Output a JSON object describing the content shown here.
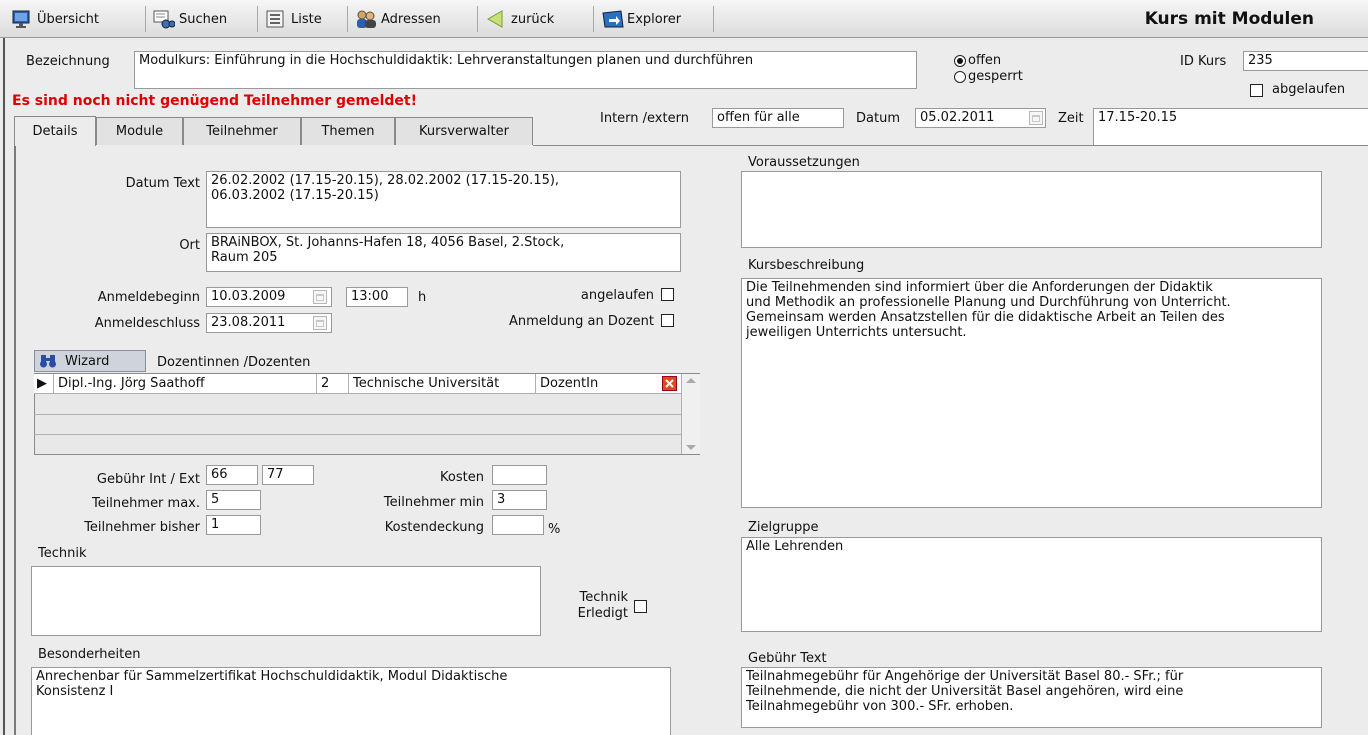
{
  "toolbar": {
    "overview": "Übersicht",
    "search": "Suchen",
    "list": "Liste",
    "addresses": "Adressen",
    "back": "zurück",
    "explorer": "Explorer",
    "title": "Kurs mit Modulen"
  },
  "header": {
    "designation_label": "Bezeichnung",
    "designation_value": "Modulkurs: Einführung in die Hochschuldidaktik: Lehrveranstaltungen planen und durchführen",
    "status_open": "offen",
    "status_locked": "gesperrt",
    "id_label": "ID Kurs",
    "id_value": "235",
    "expired_label": "abgelaufen",
    "warning": "Es sind noch nicht genügend Teilnehmer gemeldet!",
    "intern_label": "Intern /extern",
    "intern_value": "offen für alle",
    "date_label": "Datum",
    "date_value": "05.02.2011",
    "time_label": "Zeit",
    "time_value": "17.15-20.15"
  },
  "tabs": [
    "Details",
    "Module",
    "Teilnehmer",
    "Themen",
    "Kursverwalter"
  ],
  "details": {
    "date_text_label": "Datum Text",
    "date_text_value": "26.02.2002 (17.15-20.15), 28.02.2002 (17.15-20.15),\n06.03.2002 (17.15-20.15)",
    "location_label": "Ort",
    "location_value": "BRAiNBOX, St. Johanns-Hafen 18, 4056 Basel, 2.Stock,\nRaum 205",
    "reg_start_label": "Anmeldebeginn",
    "reg_start_date": "10.03.2009",
    "reg_start_time": "13:00",
    "hour_unit": "h",
    "started_label": "angelaufen",
    "reg_end_label": "Anmeldeschluss",
    "reg_end_date": "23.08.2011",
    "reg_lecturer_label": "Anmeldung an Dozent",
    "wizard_label": "Wizard",
    "lecturers_label": "Dozentinnen /Dozenten",
    "lecturers": [
      {
        "name": "Dipl.-Ing. Jörg Saathoff",
        "num": "2",
        "institution": "Technische Universität",
        "role": "DozentIn"
      }
    ],
    "fee_label": "Gebühr Int / Ext",
    "fee_int": "66",
    "fee_ext": "77",
    "cost_label": "Kosten",
    "cost_value": "",
    "max_label": "Teilnehmer max.",
    "max_value": "5",
    "min_label": "Teilnehmer min",
    "min_value": "3",
    "current_label": "Teilnehmer bisher",
    "current_value": "1",
    "coverage_label": "Kostendeckung",
    "coverage_value": "",
    "percent": "%",
    "tech_label": "Technik",
    "tech_value": "",
    "tech_done_label": "Technik\nErledigt",
    "special_label": "Besonderheiten",
    "special_value": "Anrechenbar für Sammelzertifikat Hochschuldidaktik, Modul Didaktische\nKonsistenz I"
  },
  "right": {
    "prereq_label": "Voraussetzungen",
    "prereq_value": "",
    "desc_label": "Kursbeschreibung",
    "desc_value": "Die Teilnehmenden sind informiert über die Anforderungen der Didaktik\nund Methodik an professionelle Planung und Durchführung von Unterricht.\nGemeinsam werden Ansatzstellen für die didaktische Arbeit an Teilen des\njeweiligen Unterrichts untersucht.",
    "target_label": "Zielgruppe",
    "target_value": "Alle Lehrenden",
    "fee_text_label": "Gebühr Text",
    "fee_text_value": "Teilnahmegebühr für Angehörige der Universität Basel 80.- SFr.; für\nTeilnehmende, die nicht der Universität Basel angehören, wird eine\nTeilnahmegebühr von 300.- SFr. erhoben."
  }
}
